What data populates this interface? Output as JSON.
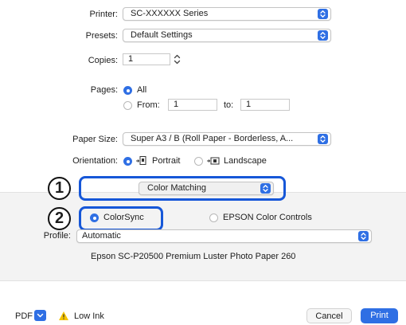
{
  "printer": {
    "label": "Printer:",
    "value": "SC-XXXXXX Series"
  },
  "presets": {
    "label": "Presets:",
    "value": "Default Settings"
  },
  "copies": {
    "label": "Copies:",
    "value": "1"
  },
  "pages": {
    "label": "Pages:",
    "all_label": "All",
    "from_label": "From:",
    "from_value": "1",
    "to_label": "to:",
    "to_value": "1",
    "selected": "All"
  },
  "paper_size": {
    "label": "Paper Size:",
    "value": "Super A3 / B (Roll Paper - Borderless, A..."
  },
  "orientation": {
    "label": "Orientation:",
    "portrait_label": "Portrait",
    "landscape_label": "Landscape",
    "selected": "Portrait"
  },
  "annotations": {
    "badge1": "1",
    "badge2": "2"
  },
  "section": {
    "value": "Color Matching"
  },
  "color_mode": {
    "colorsync_label": "ColorSync",
    "epson_label": "EPSON Color Controls",
    "selected": "ColorSync"
  },
  "profile": {
    "label": "Profile:",
    "value": "Automatic",
    "description": "Epson SC-P20500 Premium Luster Photo Paper 260"
  },
  "footer": {
    "pdf_label": "PDF",
    "low_ink_label": "Low Ink",
    "cancel_label": "Cancel",
    "print_label": "Print"
  },
  "colors": {
    "accent": "#2f6fe4",
    "annotation_border": "#1657d8",
    "warning": "#f5c400",
    "panel_bg": "#f3f3f3"
  }
}
